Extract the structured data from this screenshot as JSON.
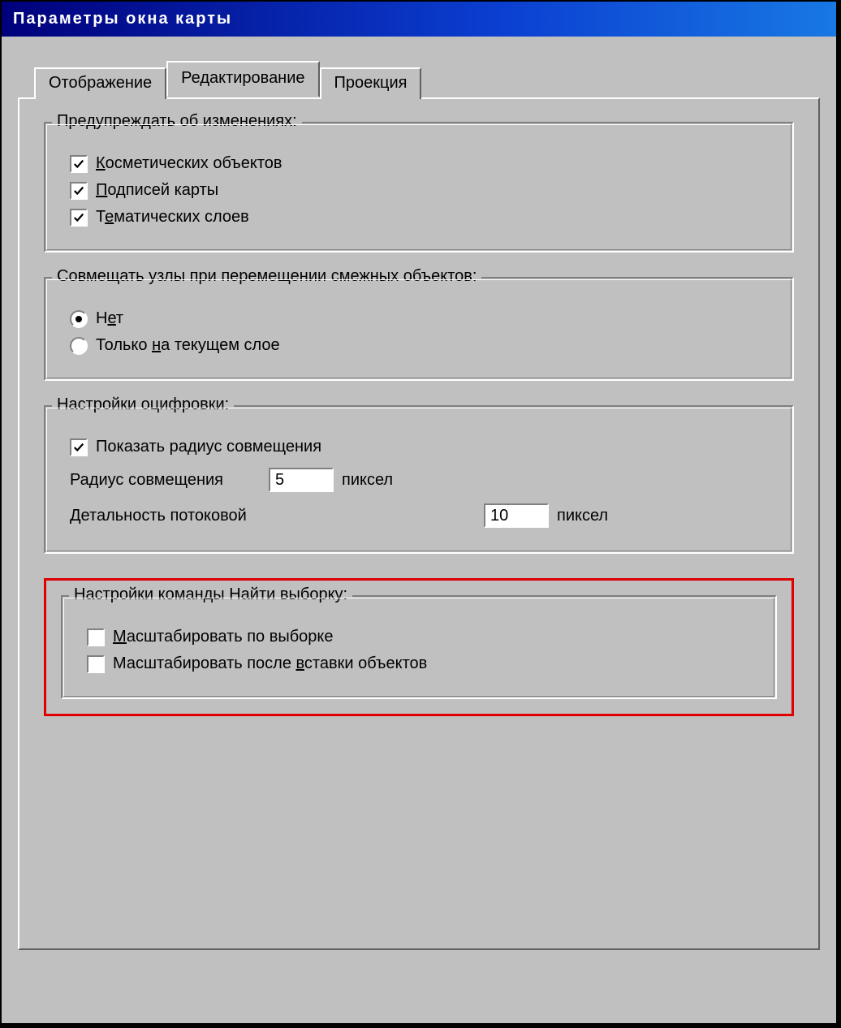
{
  "window": {
    "title": "Параметры окна карты"
  },
  "tabs": {
    "display": "Отображение",
    "editing": "Редактирование",
    "projection": "Проекция",
    "active": "editing"
  },
  "group_warn": {
    "legend": "Предупреждать об изменениях:",
    "cosmetic_pre": "К",
    "cosmetic_post": "осметических объектов",
    "cosmetic_checked": true,
    "labels_pre": "П",
    "labels_post": "одписей карты",
    "labels_checked": true,
    "thematic_pre": "Т",
    "thematic_u": "е",
    "thematic_post": "матических слоев",
    "thematic_checked": true
  },
  "group_snap": {
    "legend": "Совмещать узлы при перемещении смежных объектов:",
    "no_pre": "Н",
    "no_u": "е",
    "no_post": "т",
    "curlayer_pre": "Только ",
    "curlayer_u": "н",
    "curlayer_post": "а текущем слое",
    "selected": "no"
  },
  "group_digitize": {
    "legend": "Настройки оцифровки:",
    "showradius_label": "Показать радиус совмещения",
    "showradius_checked": true,
    "radius_label": "Радиус совмещения",
    "radius_value": "5",
    "detail_label": "Детальность потоковой",
    "detail_value": "10",
    "unit": "пиксел"
  },
  "group_find": {
    "legend": "Настройки команды Найти выборку:",
    "zoom_sel_pre": "М",
    "zoom_sel_post": "асштабировать по выборке",
    "zoom_sel_checked": false,
    "zoom_paste_pre": "Масштабировать после ",
    "zoom_paste_u": "в",
    "zoom_paste_post": "ставки объектов",
    "zoom_paste_checked": false
  }
}
